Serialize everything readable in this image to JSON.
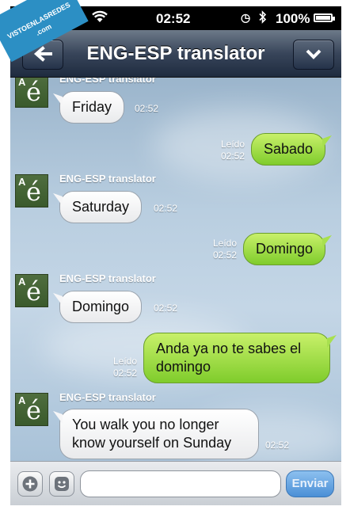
{
  "watermark": {
    "line1": "VISTOENLASREDES",
    "line2": ".com"
  },
  "status_bar": {
    "carrier": "ange",
    "time": "02:52",
    "battery": "100%",
    "battery_level": 1.0
  },
  "nav": {
    "title": "ENG-ESP translator",
    "back_icon": "arrow-left-icon",
    "menu_icon": "chevron-down-icon"
  },
  "messages": [
    {
      "direction": "in",
      "sender": "ENG-ESP translator",
      "text": "Friday",
      "time": "02:52"
    },
    {
      "direction": "out",
      "status": "Leído",
      "text": "Sabado",
      "time": "02:52"
    },
    {
      "direction": "in",
      "sender": "ENG-ESP translator",
      "text": "Saturday",
      "time": "02:52"
    },
    {
      "direction": "out",
      "status": "Leído",
      "text": "Domingo",
      "time": "02:52"
    },
    {
      "direction": "in",
      "sender": "ENG-ESP translator",
      "text": "Domingo",
      "time": "02:52"
    },
    {
      "direction": "out",
      "status": "Leído",
      "text_lines": [
        "Anda ya no te sabes el",
        "domingo"
      ],
      "time": "02:52"
    },
    {
      "direction": "in",
      "sender": "ENG-ESP translator",
      "text_lines": [
        "You walk you no longer",
        "know yourself on Sunday"
      ],
      "time": "02:52"
    }
  ],
  "avatar": {
    "letter_small": "A",
    "letter_large": "é"
  },
  "input_bar": {
    "placeholder": "",
    "send_label": "Enviar",
    "add_icon": "plus-icon",
    "emoji_icon": "smiley-icon"
  },
  "colors": {
    "incoming_bubble": "#ffffff",
    "outgoing_bubble": "#a8e04f",
    "nav_bar": "#2e3b50",
    "send_button": "#4b8fd6"
  }
}
